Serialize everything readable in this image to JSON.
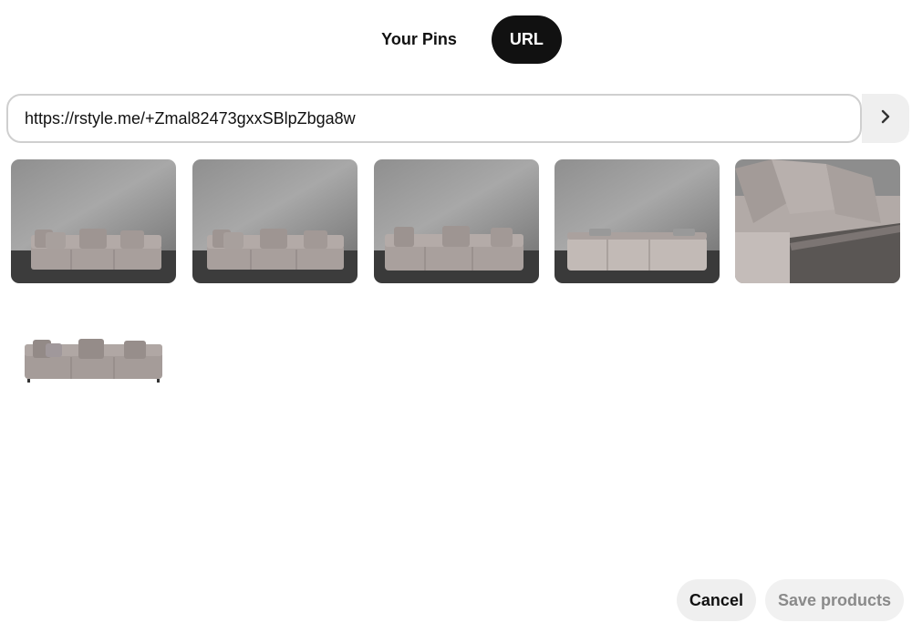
{
  "tabs": [
    {
      "label": "Your Pins",
      "active": false
    },
    {
      "label": "URL",
      "active": true
    }
  ],
  "url_input": {
    "value": "https://rstyle.me/+Zmal82473gxxSBlpZbga8w"
  },
  "images": [
    {
      "name": "sofa-front-wall-1"
    },
    {
      "name": "sofa-front-wall-2"
    },
    {
      "name": "sofa-angled-wall"
    },
    {
      "name": "sofa-back-wall"
    },
    {
      "name": "sofa-closeup-cushions"
    },
    {
      "name": "sofa-white-background"
    }
  ],
  "footer": {
    "cancel_label": "Cancel",
    "save_label": "Save products"
  },
  "icons": {
    "go": "chevron-right-icon"
  }
}
